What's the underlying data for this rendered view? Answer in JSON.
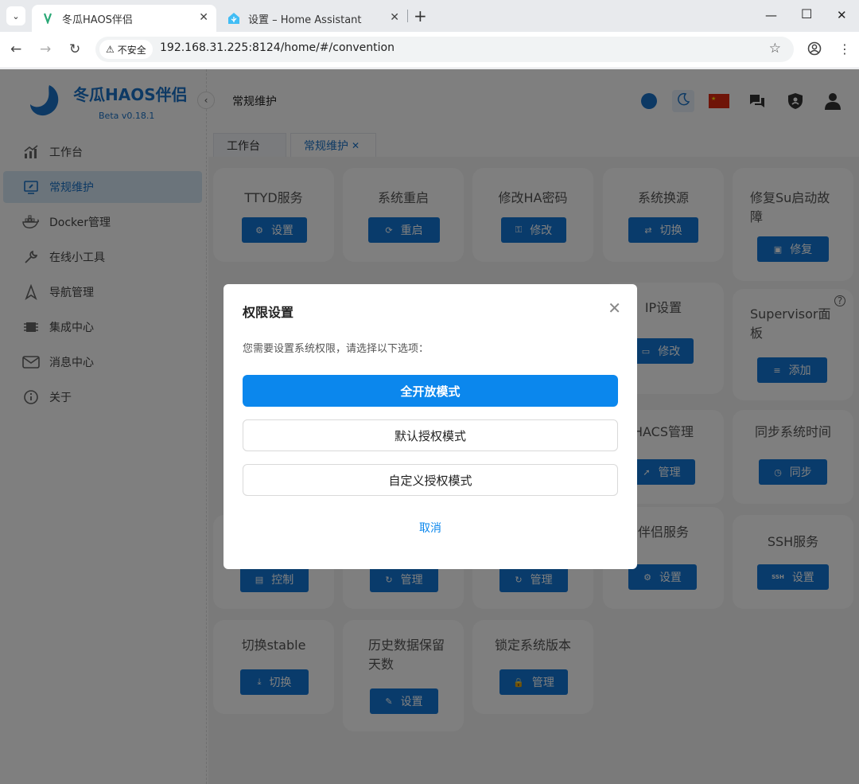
{
  "browser": {
    "tabs": [
      {
        "title": "冬瓜HAOS伴侣",
        "active": true
      },
      {
        "title": "设置 – Home Assistant",
        "active": false
      }
    ],
    "security_label": "不安全",
    "url": "192.168.31.225:8124/home/#/convention"
  },
  "app": {
    "logo_title": "冬瓜HAOS伴侣",
    "version": "Beta  v0.18.1",
    "brand_color": "#1a73c9",
    "menu": [
      {
        "label": "工作台",
        "icon": "chart-icon",
        "active": false
      },
      {
        "label": "常规维护",
        "icon": "maintenance-icon",
        "active": true
      },
      {
        "label": "Docker管理",
        "icon": "docker-icon",
        "active": false
      },
      {
        "label": "在线小工具",
        "icon": "wrench-icon",
        "active": false
      },
      {
        "label": "导航管理",
        "icon": "navigation-icon",
        "active": false
      },
      {
        "label": "集成中心",
        "icon": "chip-icon",
        "active": false
      },
      {
        "label": "消息中心",
        "icon": "mail-icon",
        "active": false
      },
      {
        "label": "关于",
        "icon": "info-icon",
        "active": false
      }
    ],
    "page_title": "常规维护",
    "page_tabs": [
      {
        "label": "工作台",
        "active": false
      },
      {
        "label": "常规维护",
        "active": true
      }
    ]
  },
  "cards": [
    {
      "title": "TTYD服务",
      "button": "设置",
      "icon": "gear-icon"
    },
    {
      "title": "系统重启",
      "button": "重启",
      "icon": "restart-icon"
    },
    {
      "title": "修改HA密码",
      "button": "修改",
      "icon": "key-icon"
    },
    {
      "title": "系统换源",
      "button": "切换",
      "icon": "switch-icon"
    },
    {
      "title": "修复Su启动故障",
      "button": "修复",
      "icon": "toolbox-icon"
    },
    {
      "title": "IP设置",
      "button": "修改",
      "icon": "monitor-icon"
    },
    {
      "title": "Supervisor面板",
      "button": "添加",
      "icon": "menu-icon"
    },
    {
      "title": "HACS管理",
      "button": "管理",
      "icon": "rocket-icon"
    },
    {
      "title": "同步系统时间",
      "button": "同步",
      "icon": "clock-icon"
    },
    {
      "button": "控制",
      "icon": "server-icon"
    },
    {
      "button": "管理",
      "icon": "refresh-icon"
    },
    {
      "button": "管理",
      "icon": "refresh-icon"
    },
    {
      "title": "伴侣服务",
      "button": "设置",
      "icon": "gear-icon"
    },
    {
      "title": "SSH服务",
      "button": "设置",
      "icon": "ssh-icon"
    },
    {
      "title": "切换stable",
      "button": "切换",
      "icon": "download-icon"
    },
    {
      "title": "历史数据保留天数",
      "button": "设置",
      "icon": "pen-icon"
    },
    {
      "title": "锁定系统版本",
      "button": "管理",
      "icon": "lock-icon"
    }
  ],
  "modal": {
    "title": "权限设置",
    "description": "您需要设置系统权限，请选择以下选项：",
    "options": [
      "全开放模式",
      "默认授权模式",
      "自定义授权模式"
    ],
    "cancel": "取消"
  }
}
